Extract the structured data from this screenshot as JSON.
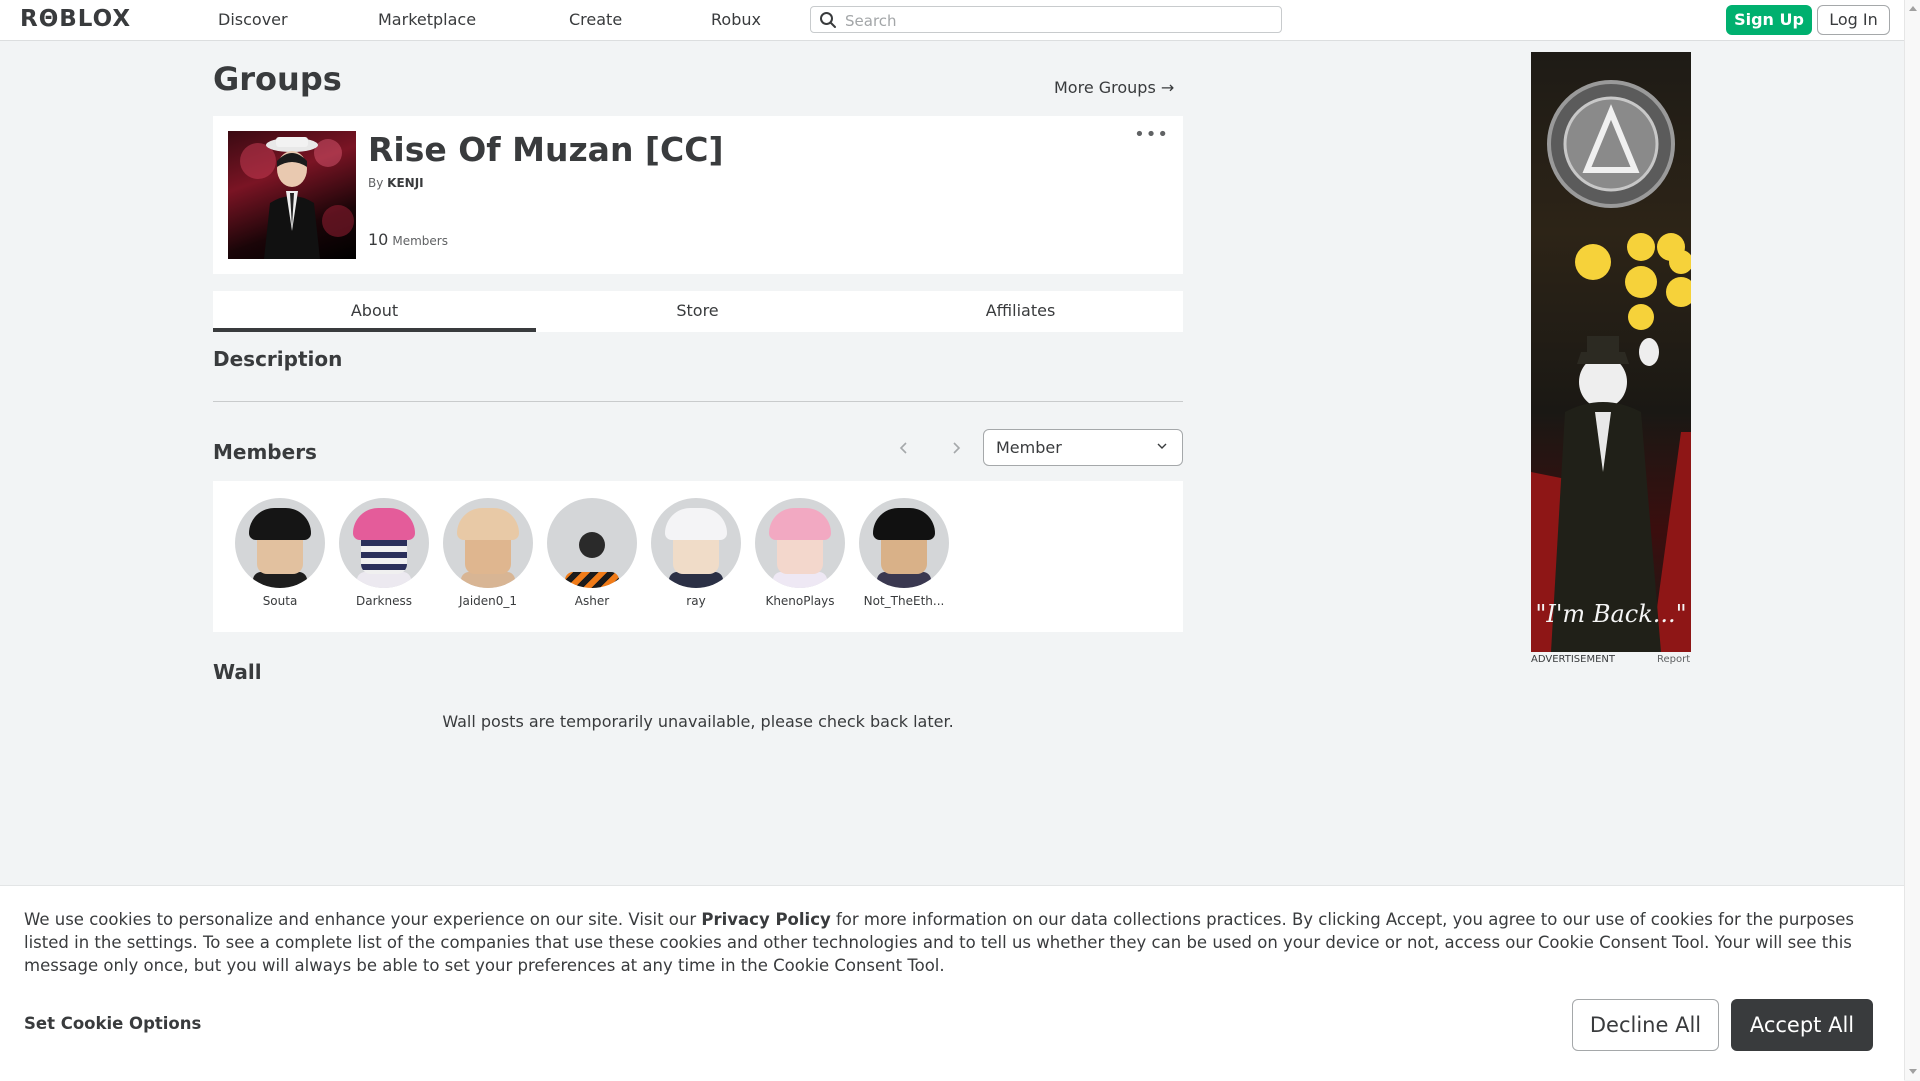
{
  "nav": {
    "logo": "RΘBLOX",
    "links": [
      "Discover",
      "Marketplace",
      "Create",
      "Robux"
    ],
    "search_placeholder": "Search",
    "signup": "Sign Up",
    "login": "Log In"
  },
  "page": {
    "title": "Groups",
    "more_groups": "More Groups →"
  },
  "group": {
    "name": "Rise Of Muzan [CC]",
    "by_prefix": "By",
    "owner": "KENJI",
    "member_count": "10",
    "member_label": "Members",
    "more_icon": "•••"
  },
  "tabs": [
    "About",
    "Store",
    "Affiliates"
  ],
  "description": {
    "heading": "Description"
  },
  "members": {
    "heading": "Members",
    "role_selected": "Member",
    "list": [
      {
        "name": "Souta"
      },
      {
        "name": "Darkness"
      },
      {
        "name": "Jaiden0_1"
      },
      {
        "name": "Asher"
      },
      {
        "name": "ray"
      },
      {
        "name": "KhenoPlays"
      },
      {
        "name": "Not_TheEth..."
      }
    ]
  },
  "wall": {
    "heading": "Wall",
    "message": "Wall posts are temporarily unavailable, please check back later."
  },
  "ad": {
    "label": "ADVERTISEMENT",
    "report": "Report",
    "caption": "\"I'm Back...\""
  },
  "cookie": {
    "text_before": "We use cookies to personalize and enhance your experience on our site. Visit our ",
    "link": "Privacy Policy",
    "text_after": " for more information on our data collections practices. By clicking Accept, you agree to our use of cookies for the purposes listed in the settings. To see a complete list of the companies that use these cookies and other technologies and to tell us whether they can be used on your device or not, access our Cookie Consent Tool. Your will see this message only once, but you will always be able to set your preferences at any time in the Cookie Consent Tool.",
    "options": "Set Cookie Options",
    "decline": "Decline All",
    "accept": "Accept All"
  }
}
